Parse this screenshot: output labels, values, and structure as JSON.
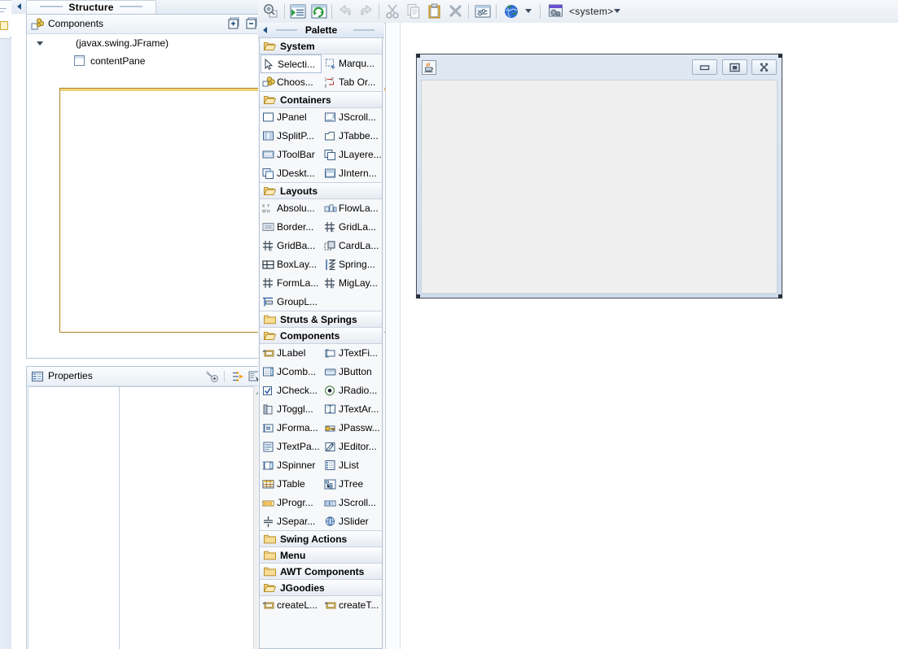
{
  "window": {
    "structure_tab_label": "Structure"
  },
  "structure": {
    "title": "Components",
    "icon": "components-icon",
    "expand_all_label": "+",
    "collapse_all_label": "−",
    "tree": [
      {
        "label": "(javax.swing.JFrame)",
        "indent": 0,
        "icon": "jframe-icon",
        "expanded": true
      },
      {
        "label": "contentPane",
        "indent": 1,
        "icon": "panel-icon",
        "expanded": false
      }
    ]
  },
  "properties": {
    "title": "Properties",
    "icon": "properties-icon",
    "toolbar": [
      {
        "name": "restore-default-value-button"
      },
      {
        "name": "show-advanced-properties-button"
      },
      {
        "name": "show-events-button"
      }
    ],
    "rows": []
  },
  "toolbar": {
    "buttons": [
      {
        "name": "test-window-button"
      },
      {
        "name": "open-source-button"
      },
      {
        "name": "refresh-button"
      },
      {
        "name": "undo-button"
      },
      {
        "name": "redo-button"
      },
      {
        "name": "cut-button"
      },
      {
        "name": "copy-button"
      },
      {
        "name": "paste-button"
      },
      {
        "name": "delete-button"
      },
      {
        "name": "externalize-strings-button"
      },
      {
        "name": "preview-locale-button"
      },
      {
        "name": "look-and-feel-button"
      }
    ],
    "laf_value": "<system>"
  },
  "palette": {
    "title": "Palette",
    "categories": [
      {
        "name": "System",
        "open": true,
        "items": [
          {
            "label": "Selecti...",
            "icon": "selection-arrow-icon",
            "selected": true
          },
          {
            "label": "Marqu...",
            "icon": "marquee-icon",
            "selected": false
          },
          {
            "label": "Choos...",
            "icon": "choose-component-icon",
            "selected": false
          },
          {
            "label": "Tab Or...",
            "icon": "tab-order-icon",
            "selected": false
          }
        ]
      },
      {
        "name": "Containers",
        "open": true,
        "items": [
          {
            "label": "JPanel",
            "icon": "jpanel-icon",
            "selected": false
          },
          {
            "label": "JScroll...",
            "icon": "jscrollpane-icon",
            "selected": false
          },
          {
            "label": "JSplitP...",
            "icon": "jsplitpane-icon",
            "selected": false
          },
          {
            "label": "JTabbe...",
            "icon": "jtabbedpane-icon",
            "selected": false
          },
          {
            "label": "JToolBar",
            "icon": "jtoolbar-icon",
            "selected": false
          },
          {
            "label": "JLayere...",
            "icon": "jlayeredpane-icon",
            "selected": false
          },
          {
            "label": "JDeskt...",
            "icon": "jdesktoppane-icon",
            "selected": false
          },
          {
            "label": "JIntern...",
            "icon": "jinternalframe-icon",
            "selected": false
          }
        ]
      },
      {
        "name": "Layouts",
        "open": true,
        "items": [
          {
            "label": "Absolu...",
            "icon": "absolute-layout-icon",
            "selected": false
          },
          {
            "label": "FlowLa...",
            "icon": "flowlayout-icon",
            "selected": false
          },
          {
            "label": "Border...",
            "icon": "borderlayout-icon",
            "selected": false
          },
          {
            "label": "GridLa...",
            "icon": "gridlayout-icon",
            "selected": false
          },
          {
            "label": "GridBa...",
            "icon": "gridbaglayout-icon",
            "selected": false
          },
          {
            "label": "CardLa...",
            "icon": "cardlayout-icon",
            "selected": false
          },
          {
            "label": "BoxLay...",
            "icon": "boxlayout-icon",
            "selected": false
          },
          {
            "label": "Spring...",
            "icon": "springlayout-icon",
            "selected": false
          },
          {
            "label": "FormLa...",
            "icon": "formlayout-icon",
            "selected": false
          },
          {
            "label": "MigLay...",
            "icon": "miglayout-icon",
            "selected": false
          },
          {
            "label": "GroupL...",
            "icon": "grouplayout-icon",
            "selected": false
          }
        ]
      },
      {
        "name": "Struts & Springs",
        "open": false,
        "items": []
      },
      {
        "name": "Components",
        "open": true,
        "items": [
          {
            "label": "JLabel",
            "icon": "jlabel-icon",
            "selected": false
          },
          {
            "label": "JTextFi...",
            "icon": "jtextfield-icon",
            "selected": false
          },
          {
            "label": "JComb...",
            "icon": "jcombobox-icon",
            "selected": false
          },
          {
            "label": "JButton",
            "icon": "jbutton-icon",
            "selected": false
          },
          {
            "label": "JCheck...",
            "icon": "jcheckbox-icon",
            "selected": false
          },
          {
            "label": "JRadio...",
            "icon": "jradiobutton-icon",
            "selected": false
          },
          {
            "label": "JToggl...",
            "icon": "jtogglebutton-icon",
            "selected": false
          },
          {
            "label": "JTextAr...",
            "icon": "jtextarea-icon",
            "selected": false
          },
          {
            "label": "JForma...",
            "icon": "jformattedtextfield-icon",
            "selected": false
          },
          {
            "label": "JPassw...",
            "icon": "jpasswordfield-icon",
            "selected": false
          },
          {
            "label": "JTextPa...",
            "icon": "jtextpane-icon",
            "selected": false
          },
          {
            "label": "JEditor...",
            "icon": "jeditorpane-icon",
            "selected": false
          },
          {
            "label": "JSpinner",
            "icon": "jspinner-icon",
            "selected": false
          },
          {
            "label": "JList",
            "icon": "jlist-icon",
            "selected": false
          },
          {
            "label": "JTable",
            "icon": "jtable-icon",
            "selected": false
          },
          {
            "label": "JTree",
            "icon": "jtree-icon",
            "selected": false
          },
          {
            "label": "JProgr...",
            "icon": "jprogressbar-icon",
            "selected": false
          },
          {
            "label": "JScroll...",
            "icon": "jscrollbar-icon",
            "selected": false
          },
          {
            "label": "JSepar...",
            "icon": "jseparator-icon",
            "selected": false
          },
          {
            "label": "JSlider",
            "icon": "jslider-icon",
            "selected": false
          }
        ]
      },
      {
        "name": "Swing Actions",
        "open": false,
        "items": []
      },
      {
        "name": "Menu",
        "open": false,
        "items": []
      },
      {
        "name": "AWT Components",
        "open": false,
        "items": []
      },
      {
        "name": "JGoodies",
        "open": true,
        "items": [
          {
            "label": "createL...",
            "icon": "jlabel-icon",
            "selected": false
          },
          {
            "label": "createT...",
            "icon": "jlabel-icon",
            "selected": false
          }
        ]
      }
    ]
  },
  "design": {
    "frame_icon": "java-cup-icon",
    "title": "",
    "buttons": [
      {
        "name": "minimize-button",
        "glyph": "minimize"
      },
      {
        "name": "maximize-button",
        "glyph": "maximize"
      },
      {
        "name": "close-button",
        "glyph": "close"
      }
    ]
  },
  "colors": {
    "accent": "#1f4f82",
    "folder": "#e0a92c",
    "frame_border": "#4a505c",
    "panel_border": "#b8c6d6",
    "content_bg": "#efefef"
  }
}
